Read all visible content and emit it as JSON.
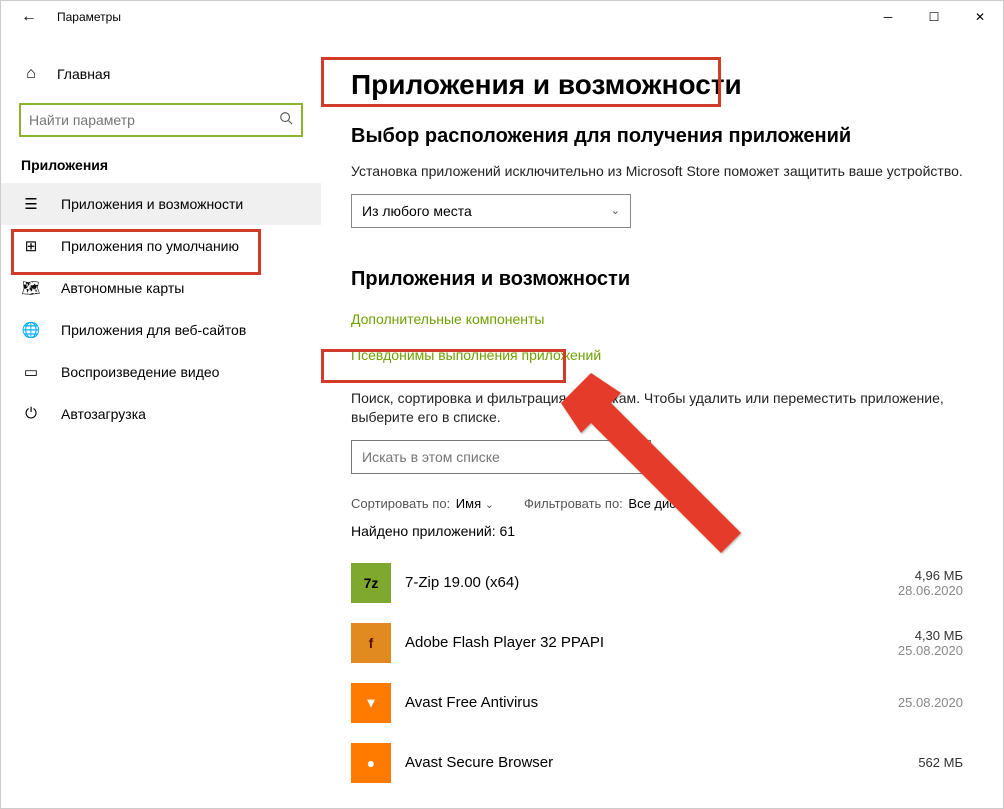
{
  "window": {
    "title": "Параметры"
  },
  "sidebar": {
    "home": "Главная",
    "search_placeholder": "Найти параметр",
    "category": "Приложения",
    "items": [
      {
        "label": "Приложения и возможности",
        "active": true
      },
      {
        "label": "Приложения по умолчанию"
      },
      {
        "label": "Автономные карты"
      },
      {
        "label": "Приложения для веб-сайтов"
      },
      {
        "label": "Воспроизведение видео"
      },
      {
        "label": "Автозагрузка"
      }
    ]
  },
  "main": {
    "title": "Приложения и возможности",
    "install_heading": "Выбор расположения для получения приложений",
    "install_desc": "Установка приложений исключительно из Microsoft Store поможет защитить ваше устройство.",
    "install_dropdown": "Из любого места",
    "apps_heading": "Приложения и возможности",
    "link_components": "Дополнительные компоненты",
    "link_aliases": "Псевдонимы выполнения приложений",
    "filter_desc": "Поиск, сортировка и фильтрация по дискам. Чтобы удалить или переместить приложение, выберите его в списке.",
    "app_search_placeholder": "Искать в этом списке",
    "sort_label": "Сортировать по:",
    "sort_value": "Имя",
    "filter_label": "Фильтровать по:",
    "filter_value": "Все диски",
    "found_label": "Найдено приложений: 61",
    "apps": [
      {
        "name": "7-Zip 19.00 (x64)",
        "size": "4,96 МБ",
        "date": "28.06.2020",
        "bg": "#7fa82e",
        "fg": "#000",
        "txt": "7z"
      },
      {
        "name": "Adobe Flash Player 32 PPAPI",
        "size": "4,30 МБ",
        "date": "25.08.2020",
        "bg": "#e08a1f",
        "fg": "#5b0f0f",
        "txt": "f"
      },
      {
        "name": "Avast Free Antivirus",
        "size": "",
        "date": "25.08.2020",
        "bg": "#ff7b00",
        "fg": "#fff",
        "txt": "▾"
      },
      {
        "name": "Avast Secure Browser",
        "size": "562 МБ",
        "date": "",
        "bg": "#ff7b00",
        "fg": "#fff",
        "txt": "●"
      }
    ]
  }
}
